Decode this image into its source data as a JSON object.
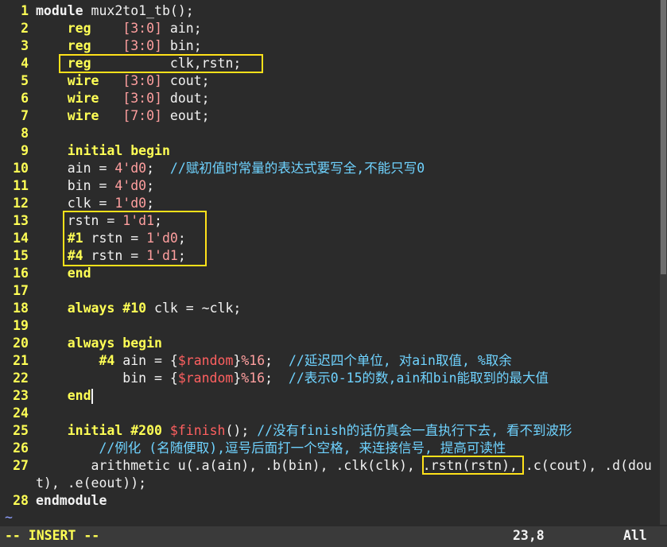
{
  "editor": {
    "lines": [
      {
        "n": "1",
        "tokens": [
          [
            "kw-n",
            "module"
          ],
          [
            "id",
            " mux2to1_tb();"
          ]
        ]
      },
      {
        "n": "2",
        "tokens": [
          [
            "id",
            "    "
          ],
          [
            "kw",
            "reg"
          ],
          [
            "id",
            "    "
          ],
          [
            "num",
            "[3:0]"
          ],
          [
            "id",
            " ain;"
          ]
        ]
      },
      {
        "n": "3",
        "tokens": [
          [
            "id",
            "    "
          ],
          [
            "kw",
            "reg"
          ],
          [
            "id",
            "    "
          ],
          [
            "num",
            "[3:0]"
          ],
          [
            "id",
            " bin;"
          ]
        ]
      },
      {
        "n": "4",
        "tokens": [
          [
            "id",
            "    "
          ],
          [
            "kw",
            "reg"
          ],
          [
            "id",
            "          clk,rstn;"
          ]
        ]
      },
      {
        "n": "5",
        "tokens": [
          [
            "id",
            "    "
          ],
          [
            "kw",
            "wire"
          ],
          [
            "id",
            "   "
          ],
          [
            "num",
            "[3:0]"
          ],
          [
            "id",
            " cout;"
          ]
        ]
      },
      {
        "n": "6",
        "tokens": [
          [
            "id",
            "    "
          ],
          [
            "kw",
            "wire"
          ],
          [
            "id",
            "   "
          ],
          [
            "num",
            "[3:0]"
          ],
          [
            "id",
            " dout;"
          ]
        ]
      },
      {
        "n": "7",
        "tokens": [
          [
            "id",
            "    "
          ],
          [
            "kw",
            "wire"
          ],
          [
            "id",
            "   "
          ],
          [
            "num",
            "[7:0]"
          ],
          [
            "id",
            " eout;"
          ]
        ]
      },
      {
        "n": "8",
        "tokens": []
      },
      {
        "n": "9",
        "tokens": [
          [
            "id",
            "    "
          ],
          [
            "kw",
            "initial"
          ],
          [
            "id",
            " "
          ],
          [
            "kw",
            "begin"
          ]
        ]
      },
      {
        "n": "10",
        "tokens": [
          [
            "id",
            "    ain = "
          ],
          [
            "num",
            "4'd0"
          ],
          [
            "id",
            ";  "
          ],
          [
            "cm",
            "//赋初值时常量的表达式要写全,不能只写0"
          ]
        ]
      },
      {
        "n": "11",
        "tokens": [
          [
            "id",
            "    bin = "
          ],
          [
            "num",
            "4'd0"
          ],
          [
            "id",
            ";"
          ]
        ]
      },
      {
        "n": "12",
        "tokens": [
          [
            "id",
            "    clk = "
          ],
          [
            "num",
            "1'd0"
          ],
          [
            "id",
            ";"
          ]
        ]
      },
      {
        "n": "13",
        "tokens": [
          [
            "id",
            "    rstn = "
          ],
          [
            "num",
            "1'd1"
          ],
          [
            "id",
            ";"
          ]
        ]
      },
      {
        "n": "14",
        "tokens": [
          [
            "id",
            "    "
          ],
          [
            "kw",
            "#1"
          ],
          [
            "id",
            " rstn = "
          ],
          [
            "num",
            "1'd0"
          ],
          [
            "id",
            ";"
          ]
        ]
      },
      {
        "n": "15",
        "tokens": [
          [
            "id",
            "    "
          ],
          [
            "kw",
            "#4"
          ],
          [
            "id",
            " rstn = "
          ],
          [
            "num",
            "1'd1"
          ],
          [
            "id",
            ";"
          ]
        ]
      },
      {
        "n": "16",
        "tokens": [
          [
            "id",
            "    "
          ],
          [
            "kw",
            "end"
          ]
        ]
      },
      {
        "n": "17",
        "tokens": []
      },
      {
        "n": "18",
        "tokens": [
          [
            "id",
            "    "
          ],
          [
            "kw",
            "always"
          ],
          [
            "id",
            " "
          ],
          [
            "kw",
            "#10"
          ],
          [
            "id",
            " clk = ~clk;"
          ]
        ]
      },
      {
        "n": "19",
        "tokens": []
      },
      {
        "n": "20",
        "tokens": [
          [
            "id",
            "    "
          ],
          [
            "kw",
            "always"
          ],
          [
            "id",
            " "
          ],
          [
            "kw",
            "begin"
          ]
        ]
      },
      {
        "n": "21",
        "tokens": [
          [
            "id",
            "        "
          ],
          [
            "kw",
            "#4"
          ],
          [
            "id",
            " ain = {"
          ],
          [
            "sys",
            "$random"
          ],
          [
            "id",
            "}"
          ],
          [
            "num",
            "%16"
          ],
          [
            "id",
            ";  "
          ],
          [
            "cm",
            "//延迟四个单位, 对ain取值, %取余"
          ]
        ]
      },
      {
        "n": "22",
        "tokens": [
          [
            "id",
            "           bin = {"
          ],
          [
            "sys",
            "$random"
          ],
          [
            "id",
            "}"
          ],
          [
            "num",
            "%16"
          ],
          [
            "id",
            ";  "
          ],
          [
            "cm",
            "//表示0-15的数,ain和bin能取到的最大值"
          ]
        ]
      },
      {
        "n": "23",
        "tokens": [
          [
            "id",
            "    "
          ],
          [
            "kw",
            "end"
          ]
        ]
      },
      {
        "n": "24",
        "tokens": []
      },
      {
        "n": "25",
        "tokens": [
          [
            "id",
            "    "
          ],
          [
            "kw",
            "initial"
          ],
          [
            "id",
            " "
          ],
          [
            "kw",
            "#200"
          ],
          [
            "id",
            " "
          ],
          [
            "sys",
            "$finish"
          ],
          [
            "id",
            "(); "
          ],
          [
            "cm",
            "//没有finish的话仿真会一直执行下去, 看不到波形"
          ]
        ]
      },
      {
        "n": "26",
        "tokens": [
          [
            "id",
            "        "
          ],
          [
            "cm",
            "//例化 (名随便取),逗号后面打一个空格, 来连接信号, 提高可读性"
          ]
        ]
      },
      {
        "n": "27",
        "tokens": [
          [
            "id",
            "       arithmetic u(.a(ain), .b(bin), .clk(clk), .rstn(rstn), .c(cout), .d(dou"
          ]
        ]
      },
      {
        "n": "",
        "tokens": [
          [
            "id",
            "t), .e(eout));"
          ]
        ]
      },
      {
        "n": "28",
        "tokens": [
          [
            "kw-n",
            "endmodule"
          ]
        ]
      }
    ],
    "tilde": "~"
  },
  "statusbar": {
    "mode": "-- INSERT --",
    "position": "23,8",
    "scroll": "All"
  },
  "colors": {
    "background": "#2b2b2b",
    "keyword": "#ffff55",
    "number": "#ff9f9f",
    "comment": "#6fd3ff",
    "system_task": "#ff6060",
    "highlight_box": "#ffe11a"
  }
}
